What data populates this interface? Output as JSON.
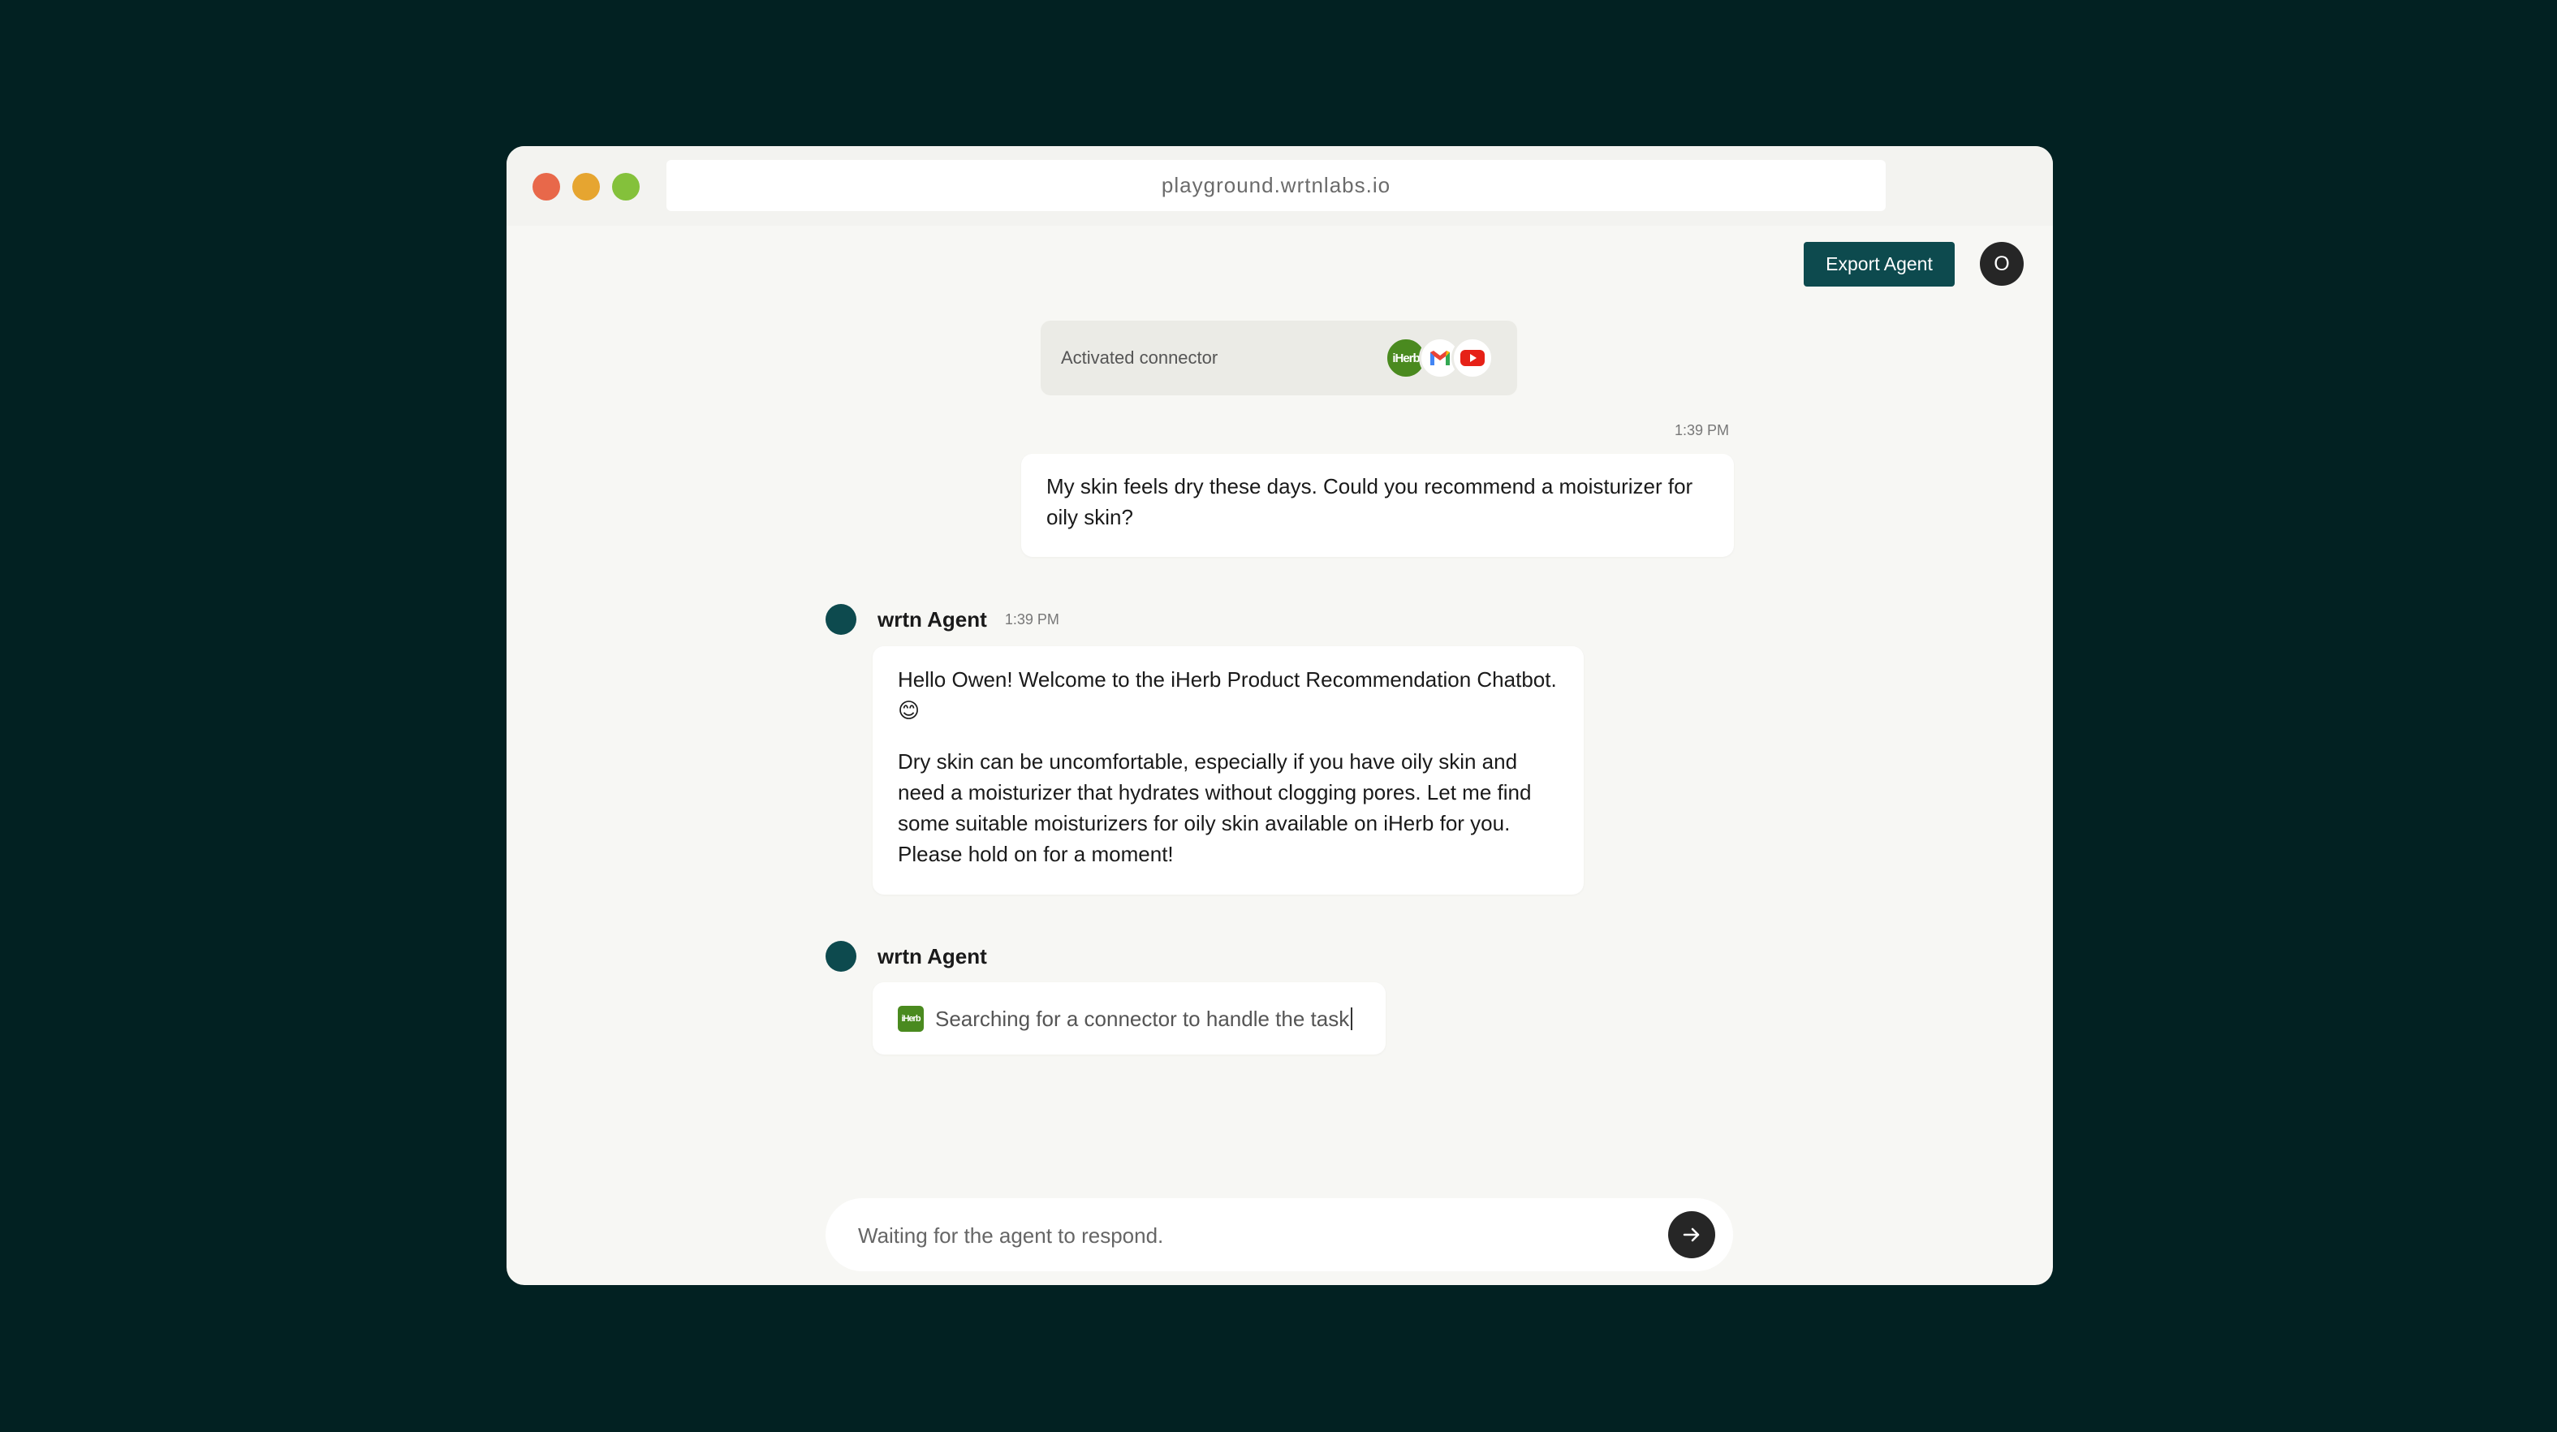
{
  "browser": {
    "url": "playground.wrtnlabs.io"
  },
  "header": {
    "export_label": "Export Agent",
    "user_initial": "O"
  },
  "connector": {
    "label": "Activated connector",
    "icons": [
      "iherb-icon",
      "gmail-icon",
      "youtube-icon"
    ],
    "iherb_text": "iHerb"
  },
  "messages": {
    "user": {
      "time": "1:39 PM",
      "text": "My skin feels dry these days. Could you recommend a moisturizer for oily skin?"
    },
    "agent1": {
      "name": "wrtn Agent",
      "time": "1:39 PM",
      "para1": "Hello Owen! Welcome to the iHerb Product Recommendation Chatbot. 😊",
      "para2": "Dry skin can be uncomfortable, especially if you have oily skin and need a moisturizer that hydrates without clogging pores. Let me find some suitable moisturizers for oily skin available on iHerb for you. Please hold on for a moment!"
    },
    "agent2": {
      "name": "wrtn Agent",
      "status": "Searching for a connector to handle the task",
      "icon_text": "iHerb"
    }
  },
  "composer": {
    "placeholder": "Waiting for the agent to respond."
  },
  "colors": {
    "background": "#022122",
    "accent": "#0d4a4e",
    "iherb_green": "#4a8a1f"
  }
}
